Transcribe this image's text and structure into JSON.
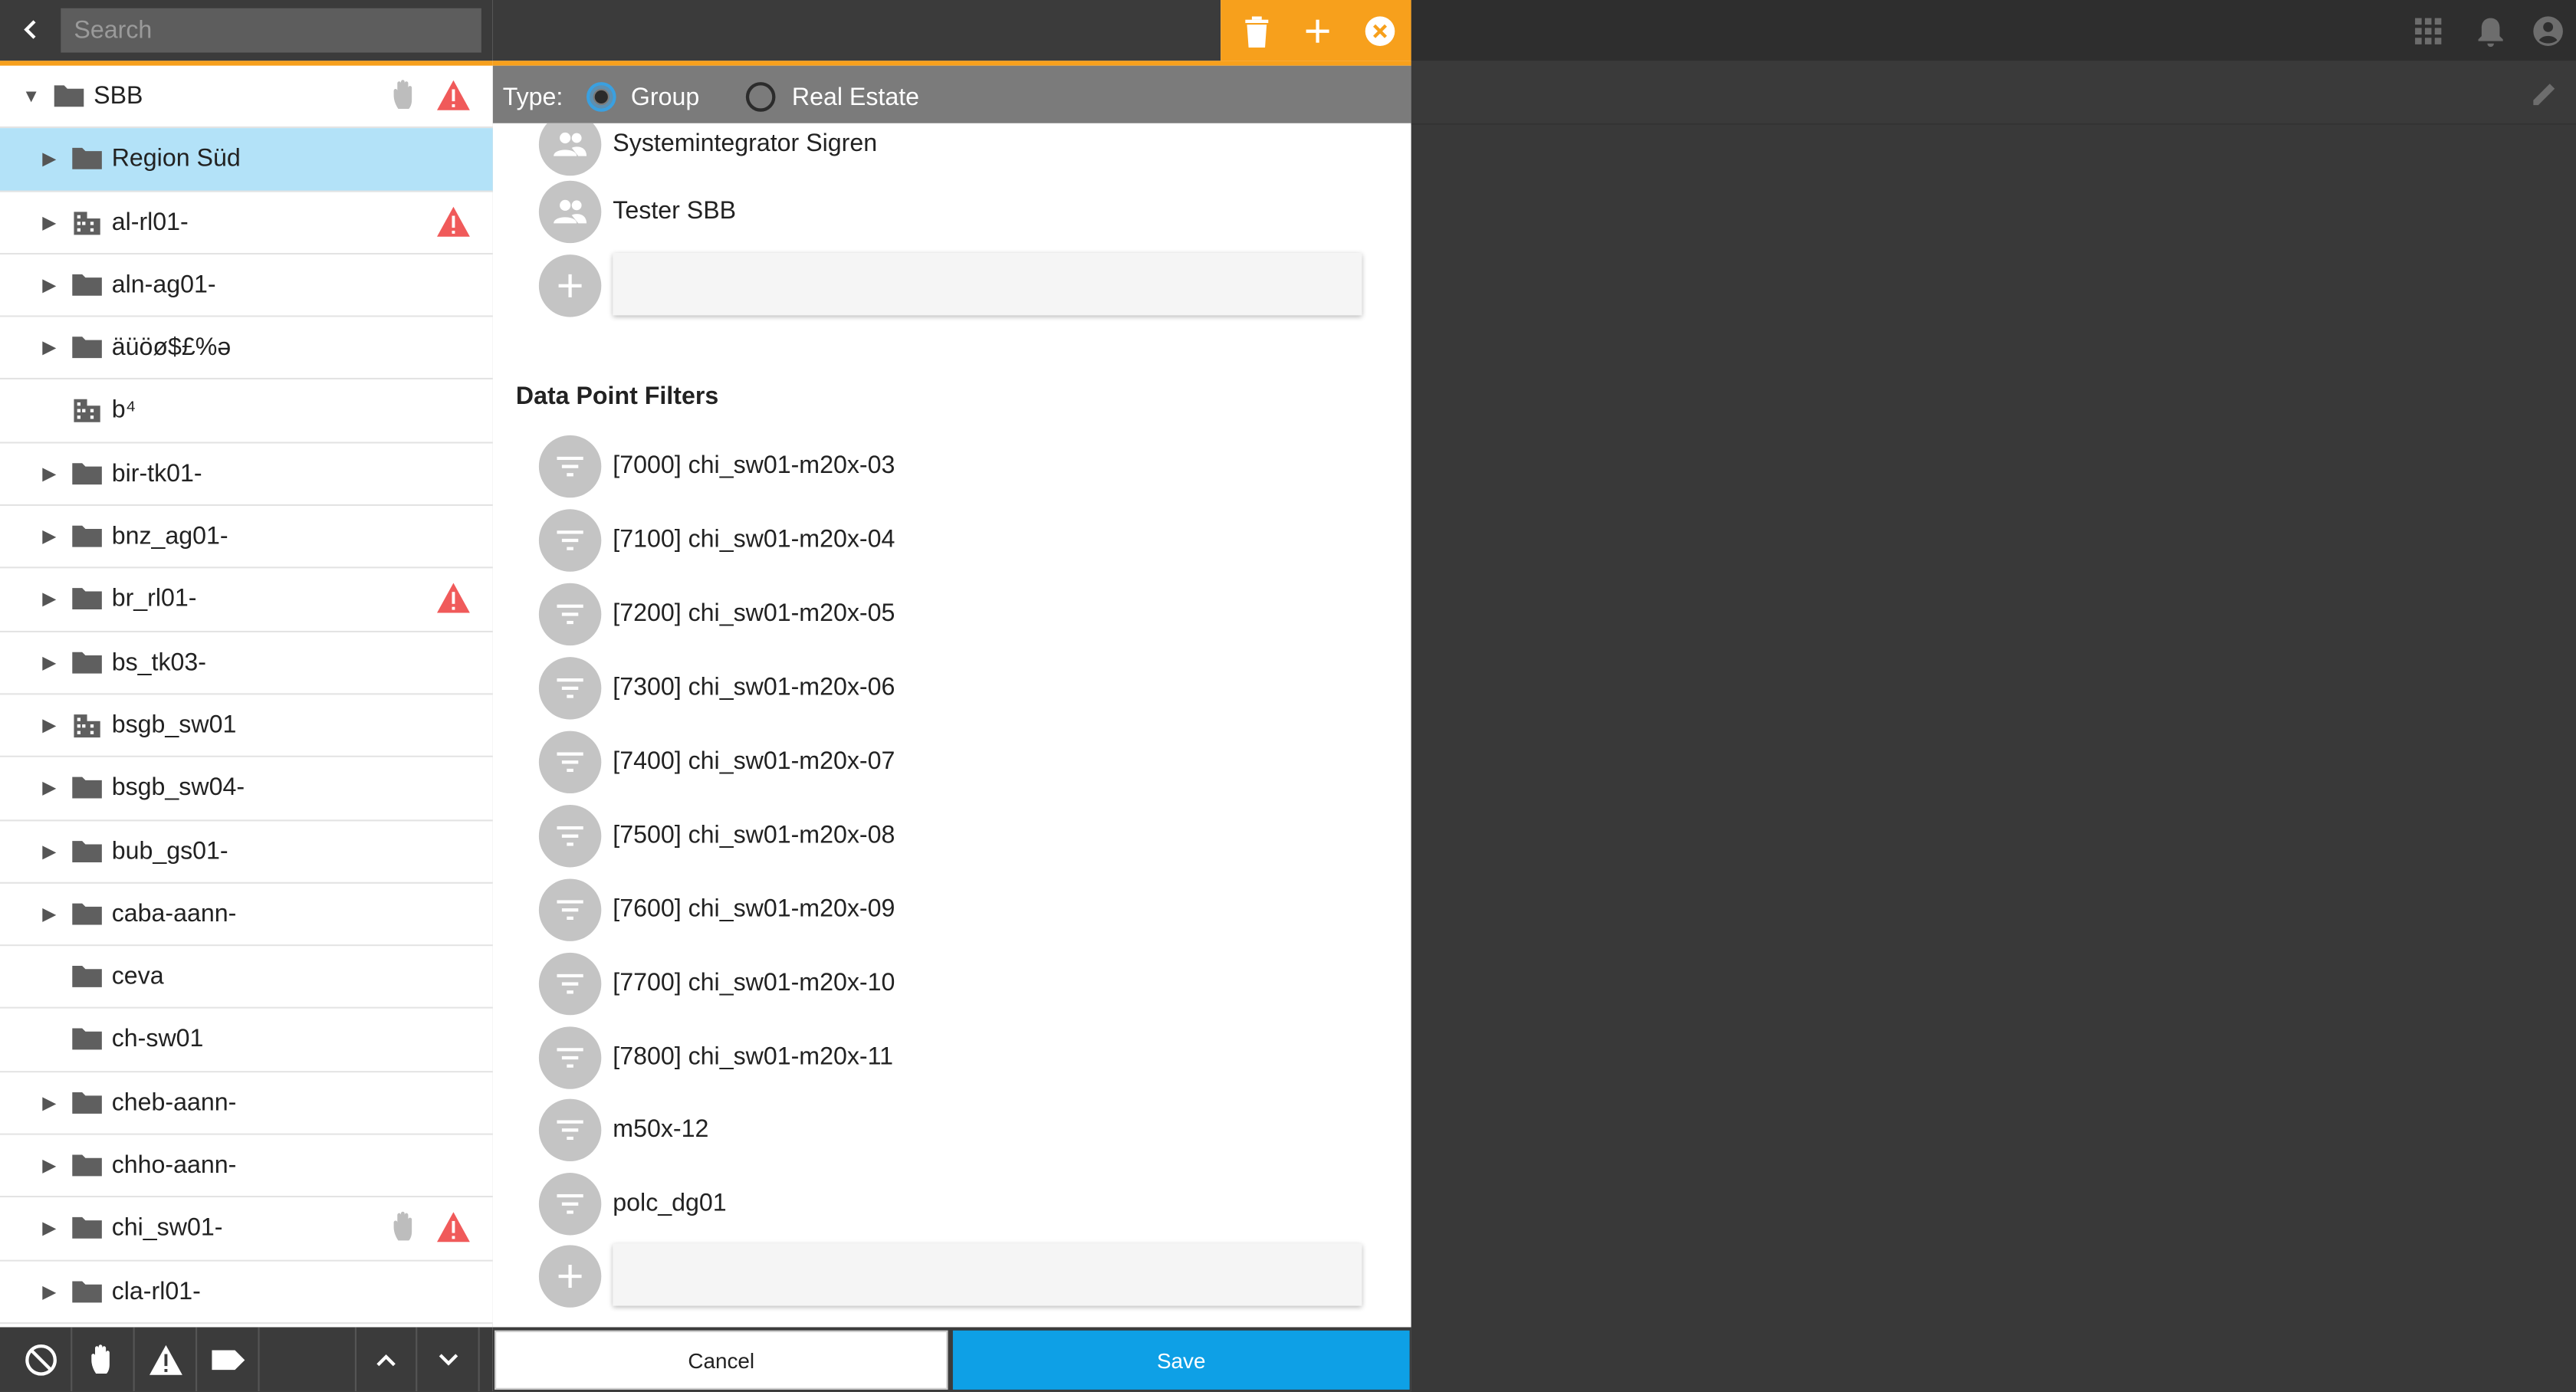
{
  "search": {
    "placeholder": "Search"
  },
  "tree": {
    "items": [
      {
        "label": "SBB"
      },
      {
        "label": "Region Süd"
      },
      {
        "label": "al-rl01-"
      },
      {
        "label": "aln-ag01-"
      },
      {
        "label": "äüöø$£%ə"
      },
      {
        "label": "b⁴"
      },
      {
        "label": "bir-tk01-"
      },
      {
        "label": "bnz_ag01-"
      },
      {
        "label": "br_rl01-"
      },
      {
        "label": "bs_tk03-"
      },
      {
        "label": "bsgb_sw01"
      },
      {
        "label": "bsgb_sw04-"
      },
      {
        "label": "bub_gs01-"
      },
      {
        "label": "caba-aann-"
      },
      {
        "label": "ceva"
      },
      {
        "label": "ch-sw01"
      },
      {
        "label": "cheb-aann-"
      },
      {
        "label": "chho-aann-"
      },
      {
        "label": "chi_sw01-"
      },
      {
        "label": "cla-rl01-"
      }
    ]
  },
  "dialog": {
    "type_label": "Type:",
    "type_options": [
      "Group",
      "Real Estate"
    ],
    "selected_type": "Group",
    "groups": [
      "Systemintegrator Sigren",
      "Tester SBB"
    ],
    "filters_title": "Data Point Filters",
    "filters": [
      "[7000] chi_sw01-m20x-03",
      "[7100] chi_sw01-m20x-04",
      "[7200] chi_sw01-m20x-05",
      "[7300] chi_sw01-m20x-06",
      "[7400] chi_sw01-m20x-07",
      "[7500] chi_sw01-m20x-08",
      "[7600] chi_sw01-m20x-09",
      "[7700] chi_sw01-m20x-10",
      "[7800] chi_sw01-m20x-11",
      "m50x-12",
      "polc_dg01"
    ],
    "cancel_label": "Cancel",
    "save_label": "Save"
  },
  "colors": {
    "accent": "#f7a01c",
    "save": "#0ea0e6",
    "selected_row": "#b3e2f8",
    "warning": "#f05a5a"
  }
}
